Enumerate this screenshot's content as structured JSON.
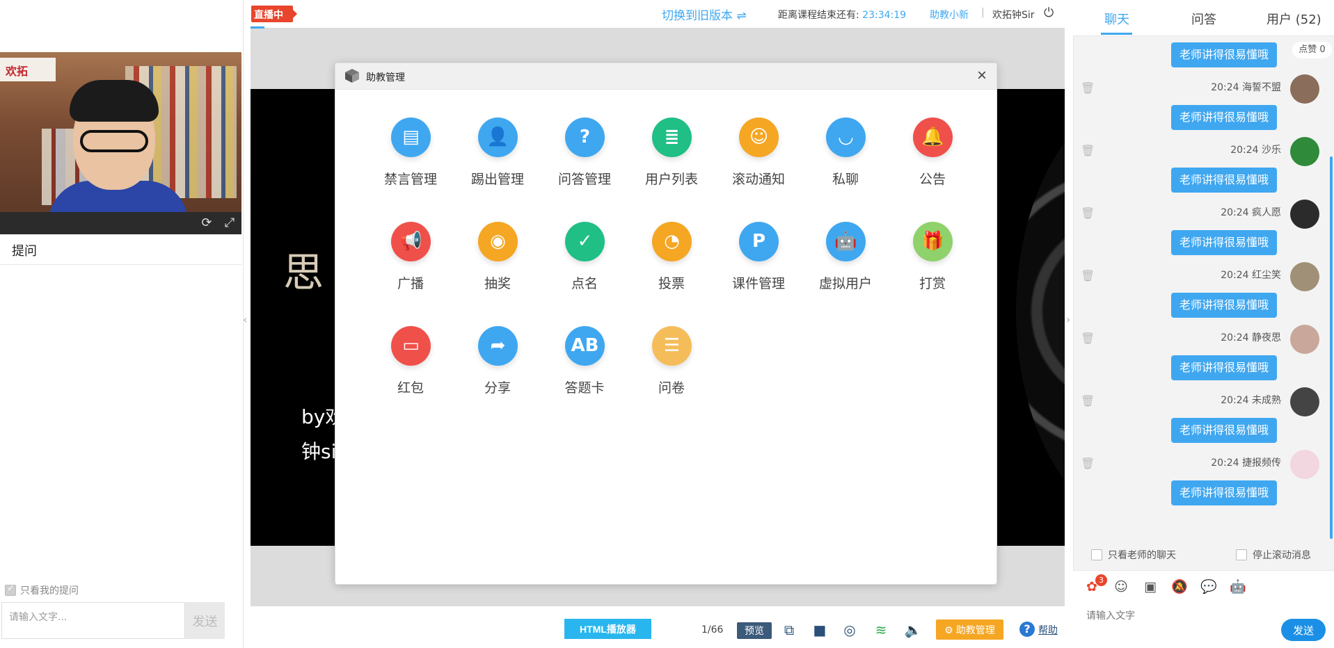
{
  "header": {
    "live_label": "直播中",
    "switch_old_label": "切换到旧版本 ⇌",
    "countdown_label": "距离课程结束还有:",
    "countdown_value": "23:34:19",
    "assistant_name": "助教小新",
    "separator": "|",
    "welcome_text": "欢拓钟Sir"
  },
  "left": {
    "video_logo": "欢拓",
    "ask_tab_label": "提问",
    "only_mine_label": "只看我的提问",
    "ask_input_placeholder": "请输入文字...",
    "ask_send_label": "发送"
  },
  "slide": {
    "title": "思",
    "by_line": "by欢",
    "name_line": "钟si"
  },
  "dialog": {
    "title": "助教管理",
    "close_label": "×",
    "tools": [
      {
        "label": "禁言管理",
        "icon": "mute-manage-icon",
        "color": "#3fa7f0",
        "glyph": "▤"
      },
      {
        "label": "踢出管理",
        "icon": "kick-manage-icon",
        "color": "#3fa7f0",
        "glyph": "👤"
      },
      {
        "label": "问答管理",
        "icon": "qa-manage-icon",
        "color": "#3fa7f0",
        "glyph": "?"
      },
      {
        "label": "用户列表",
        "icon": "user-list-icon",
        "color": "#1fbf86",
        "glyph": "≣"
      },
      {
        "label": "滚动通知",
        "icon": "scroll-notice-icon",
        "color": "#f5a623",
        "glyph": "☺"
      },
      {
        "label": "私聊",
        "icon": "private-chat-icon",
        "color": "#3fa7f0",
        "glyph": "◡"
      },
      {
        "label": "公告",
        "icon": "announcement-icon",
        "color": "#f0504a",
        "glyph": "🔔"
      },
      {
        "label": "广播",
        "icon": "broadcast-icon",
        "color": "#f0504a",
        "glyph": "📢"
      },
      {
        "label": "抽奖",
        "icon": "lottery-icon",
        "color": "#f5a623",
        "glyph": "◉"
      },
      {
        "label": "点名",
        "icon": "roll-call-icon",
        "color": "#1fbf86",
        "glyph": "✓"
      },
      {
        "label": "投票",
        "icon": "vote-icon",
        "color": "#f5a623",
        "glyph": "◔"
      },
      {
        "label": "课件管理",
        "icon": "courseware-manage-icon",
        "color": "#3fa7f0",
        "glyph": "P"
      },
      {
        "label": "虚拟用户",
        "icon": "virtual-user-icon",
        "color": "#3fa7f0",
        "glyph": "🤖"
      },
      {
        "label": "打赏",
        "icon": "reward-icon",
        "color": "#8fd16a",
        "glyph": "🎁"
      },
      {
        "label": "红包",
        "icon": "red-packet-icon",
        "color": "#f0504a",
        "glyph": "▭"
      },
      {
        "label": "分享",
        "icon": "share-icon",
        "color": "#3fa7f0",
        "glyph": "➦"
      },
      {
        "label": "答题卡",
        "icon": "answer-card-icon",
        "color": "#3fa7f0",
        "glyph": "AB"
      },
      {
        "label": "问卷",
        "icon": "questionnaire-icon",
        "color": "#f5bd5a",
        "glyph": "☰"
      }
    ]
  },
  "bottombar": {
    "html_player_label": "HTML播放器",
    "page_info": "1/66",
    "preview_label": "预览",
    "assist_manage_label": "⚙ 助教管理",
    "help_label": "帮助"
  },
  "right": {
    "tabs": {
      "chat": "聊天",
      "qa": "问答",
      "users": "用户 (52)"
    },
    "like_label": "点赞 0",
    "top_bubble": "老师讲得很易懂哦",
    "messages": [
      {
        "time_user": "20:24 海誓不盟",
        "text": "老师讲得很易懂哦",
        "avatar_color": "#8a6d5a"
      },
      {
        "time_user": "20:24 沙乐",
        "text": "老师讲得很易懂哦",
        "avatar_color": "#2f8a3a"
      },
      {
        "time_user": "20:24 疯人愿",
        "text": "老师讲得很易懂哦",
        "avatar_color": "#2b2b2b"
      },
      {
        "time_user": "20:24 红尘笑",
        "text": "老师讲得很易懂哦",
        "avatar_color": "#a09078"
      },
      {
        "time_user": "20:24 静夜思",
        "text": "老师讲得很易懂哦",
        "avatar_color": "#c9a79a"
      },
      {
        "time_user": "20:24 未成熟",
        "text": "老师讲得很易懂哦",
        "avatar_color": "#444444"
      },
      {
        "time_user": "20:24 捷报频传",
        "text": "老师讲得很易懂哦",
        "avatar_color": "#f2d6e0"
      }
    ],
    "opt_teacher_label": "只看老师的聊天",
    "opt_stop_label": "停止滚动消息",
    "flower_count": "3",
    "input_placeholder": "请输入文字",
    "send_label": "发送"
  }
}
